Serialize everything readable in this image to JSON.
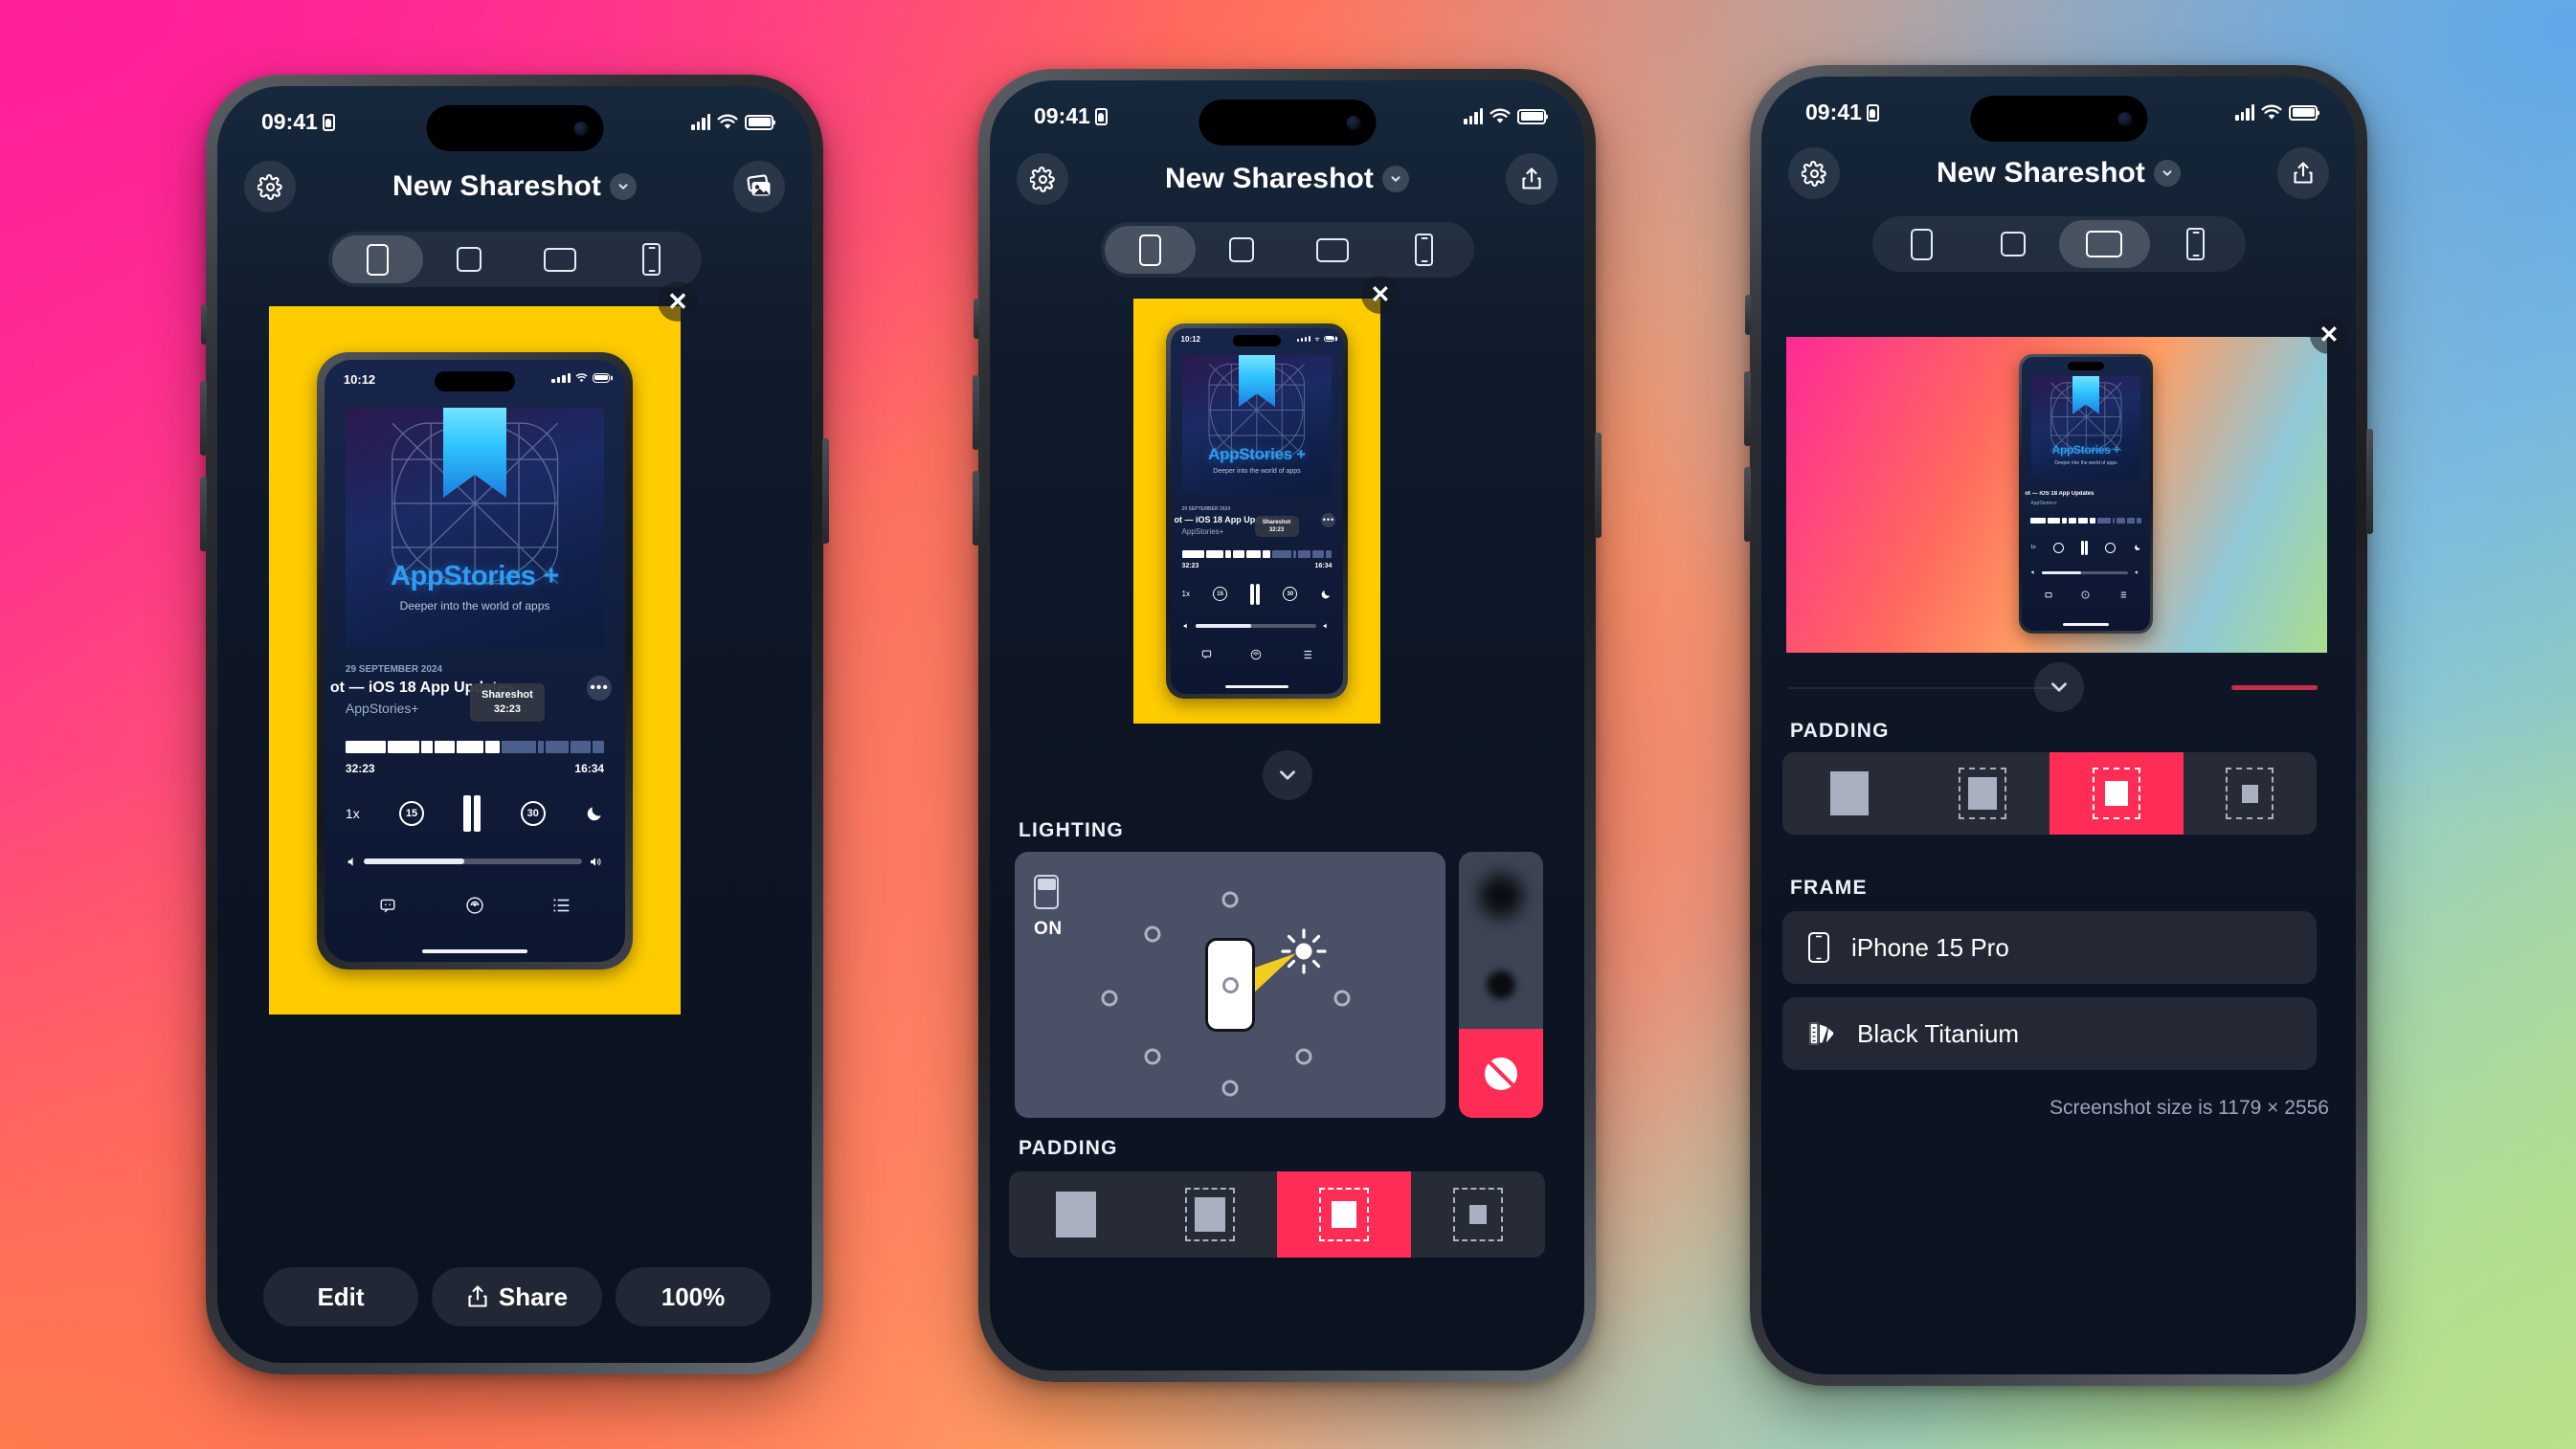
{
  "app": {
    "name": "Shareshot"
  },
  "phones": [
    {
      "id": "phone-1",
      "status": {
        "time": "09:41",
        "icons": [
          "record-badge-icon",
          "cellular-icon",
          "wifi-icon",
          "battery-icon"
        ]
      },
      "nav": {
        "left_icon": "gear-icon",
        "title": "New Shareshot",
        "chevron_icon": "chevron-down-icon",
        "right_icon": "photos-icon"
      },
      "segmented": {
        "options": [
          {
            "icon": "phone-portrait-icon",
            "selected": true
          },
          {
            "icon": "square-icon",
            "selected": false
          },
          {
            "icon": "landscape-icon",
            "selected": false
          },
          {
            "icon": "device-icon",
            "selected": false
          }
        ]
      },
      "canvas": {
        "background_color": "#FFCC00",
        "close_icon": "close-icon",
        "screenshot": {
          "status_time": "10:12",
          "artwork_title": "AppStories +",
          "artwork_subtitle": "Deeper into the world of apps",
          "date": "29 SEPTEMBER 2024",
          "episode": "ot — iOS 18 App Updates",
          "show": "AppStories+",
          "more_icon": "ellipsis-icon",
          "tooltip_title": "Shareshot",
          "tooltip_time": "32:23",
          "elapsed": "32:23",
          "remaining": "16:34",
          "speed": "1x",
          "back_seconds": "15",
          "forward_seconds": "30",
          "play_state_icon": "pause-icon",
          "sleep_icon": "moon-icon",
          "tabs": [
            "transcript-icon",
            "airplay-icon",
            "queue-icon"
          ]
        }
      },
      "bottom_buttons": [
        {
          "label": "Edit",
          "icon": null
        },
        {
          "label": "Share",
          "icon": "share-icon"
        },
        {
          "label": "100%",
          "icon": null
        }
      ]
    },
    {
      "id": "phone-2",
      "status": {
        "time": "09:41"
      },
      "nav": {
        "left_icon": "gear-icon",
        "title": "New Shareshot",
        "chevron_icon": "chevron-down-icon",
        "right_icon": "share-icon"
      },
      "segmented": {
        "options": [
          {
            "icon": "phone-portrait-icon",
            "selected": true
          },
          {
            "icon": "square-icon",
            "selected": false
          },
          {
            "icon": "landscape-icon",
            "selected": false
          },
          {
            "icon": "device-icon",
            "selected": false
          }
        ]
      },
      "canvas": {
        "background_color": "#FFCC00",
        "close_icon": "close-icon"
      },
      "sheet": {
        "grabber_icon": "chevron-down-icon",
        "lighting": {
          "label": "LIGHTING",
          "toggle_icon": "light-toggle-icon",
          "toggle_state": "ON",
          "sun_icon": "sun-icon",
          "presets": [
            "soft-shadow-preset",
            "hard-shadow-preset",
            "no-shadow-preset"
          ],
          "selected_preset": "no-shadow-preset",
          "no-shadow_icon": "no-shadow-icon"
        },
        "padding": {
          "label": "PADDING",
          "options": [
            {
              "icon": "padding-none-icon",
              "selected": false
            },
            {
              "icon": "padding-small-icon",
              "selected": false
            },
            {
              "icon": "padding-medium-icon",
              "selected": true
            },
            {
              "icon": "padding-large-icon",
              "selected": false
            }
          ]
        }
      }
    },
    {
      "id": "phone-3",
      "status": {
        "time": "09:41"
      },
      "nav": {
        "left_icon": "gear-icon",
        "title": "New Shareshot",
        "chevron_icon": "chevron-down-icon",
        "right_icon": "share-icon"
      },
      "segmented": {
        "options": [
          {
            "icon": "phone-portrait-icon",
            "selected": false
          },
          {
            "icon": "square-icon",
            "selected": false
          },
          {
            "icon": "landscape-icon",
            "selected": true
          },
          {
            "icon": "device-icon",
            "selected": false
          }
        ]
      },
      "canvas": {
        "background_gradient": "pink-to-green",
        "close_icon": "close-icon"
      },
      "sheet": {
        "grabber_icon": "chevron-down-icon",
        "padding": {
          "label": "PADDING",
          "options": [
            {
              "icon": "padding-none-icon",
              "selected": false
            },
            {
              "icon": "padding-small-icon",
              "selected": false
            },
            {
              "icon": "padding-medium-icon",
              "selected": true
            },
            {
              "icon": "padding-large-icon",
              "selected": false
            }
          ]
        },
        "frame": {
          "label": "FRAME",
          "rows": [
            {
              "icon": "device-icon",
              "label": "iPhone 15 Pro"
            },
            {
              "icon": "color-swatch-icon",
              "label": "Black Titanium"
            }
          ]
        },
        "footnote": "Screenshot size is 1179 × 2556"
      }
    }
  ],
  "colors": {
    "accent": "#FF2D55",
    "canvas_yellow": "#FFCC00",
    "screen_bg": "#0B1220",
    "card_bg": "#232834"
  }
}
